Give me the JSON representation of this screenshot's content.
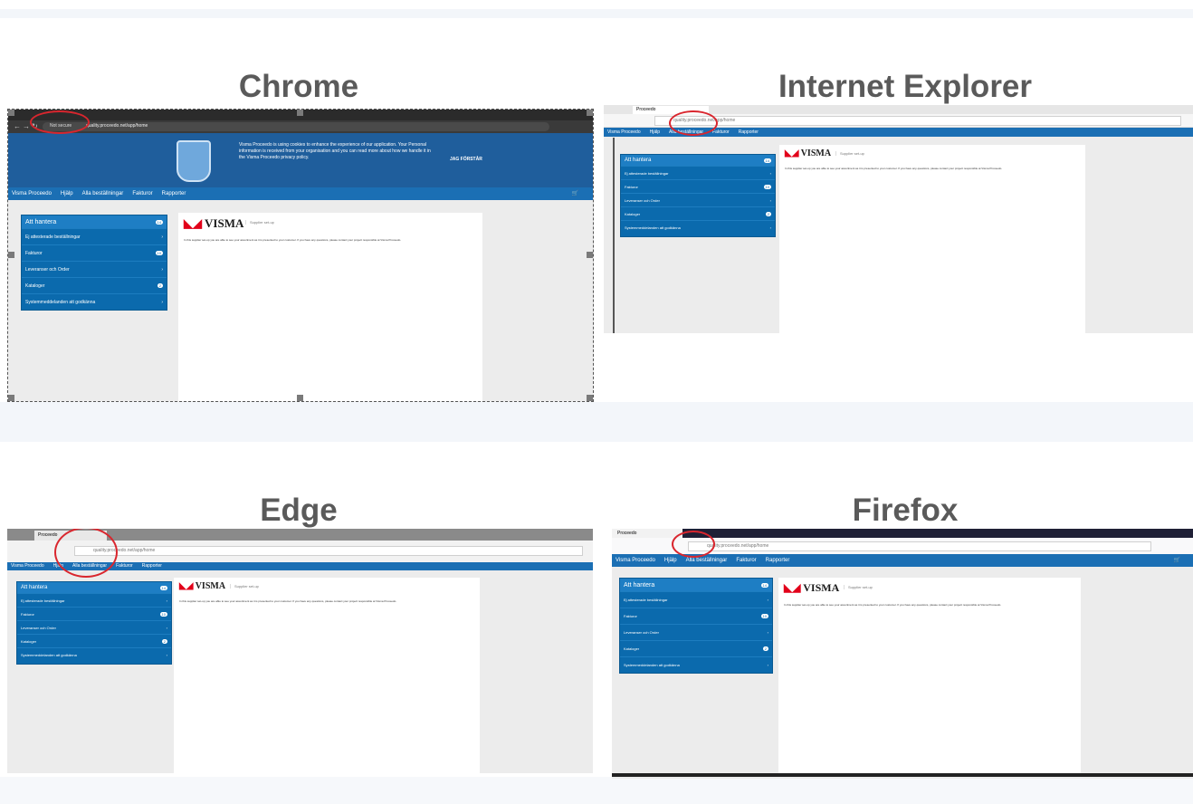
{
  "titles": {
    "chrome": "Chrome",
    "ie": "Internet Explorer",
    "edge": "Edge",
    "firefox": "Firefox"
  },
  "browser": {
    "tab_label": "Proceedo",
    "not_secure": "Not secure",
    "url": "quality.proceedo.net/app/home"
  },
  "app": {
    "nav": [
      "Visma Proceedo",
      "Hjälp",
      "Alla beställningar",
      "Fakturor",
      "Rapporter"
    ],
    "menu_header": "Att hantera",
    "menu_header_count": "14",
    "menu_items": [
      {
        "label": "Ej attesterade beställningar",
        "count": ""
      },
      {
        "label": "Fakturor",
        "count": "10"
      },
      {
        "label": "Leveranser och Order",
        "count": ""
      },
      {
        "label": "Kataloger",
        "count": "2"
      },
      {
        "label": "Systemmeddelanden att godkänna",
        "count": ""
      }
    ],
    "logo": "VISMA",
    "subtitle": "Supplier set-up",
    "body_text": "In this supplier set-up you are able to see your assortment as it is presented to your customer. If you have any questions, please contact your project responsible at Visma Proceedo.",
    "cookie_text": "Visma Proceedo is using cookies to enhance the experience of our application. Your Personal information is received from your organisation and you can read more about how we handle it in the Visma Proceedo privacy policy.",
    "cookie_button": "JAG FÖRSTÅR"
  },
  "colors": {
    "nav_blue": "#1b6fb4",
    "menu_blue": "#0b6aad",
    "annotation_red": "#d9262e"
  }
}
